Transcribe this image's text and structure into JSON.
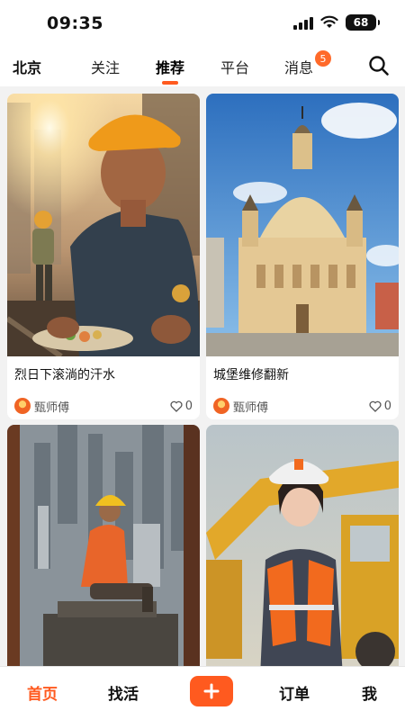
{
  "status_bar": {
    "time": "09:35",
    "battery": "68"
  },
  "top_nav": {
    "city": "北京",
    "tabs": [
      {
        "label": "关注"
      },
      {
        "label": "推荐",
        "active": true
      },
      {
        "label": "平台"
      },
      {
        "label": "消息",
        "badge": "5"
      }
    ]
  },
  "feed": {
    "cards": [
      {
        "title": "烈日下滚淌的汗水",
        "author": "甄师傅",
        "likes": "0"
      },
      {
        "title": "城堡维修翻新",
        "author": "甄师傅",
        "likes": "0"
      },
      {
        "title": "",
        "author": "",
        "likes": ""
      },
      {
        "title": "",
        "author": "",
        "likes": ""
      }
    ]
  },
  "bottom_nav": {
    "home": "首页",
    "find_work": "找活",
    "orders": "订单",
    "me": "我"
  },
  "colors": {
    "accent": "#ff5a1f"
  }
}
